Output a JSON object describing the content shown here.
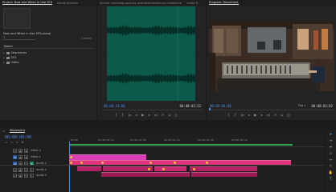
{
  "project": {
    "tab_project": "Project: Now and When in Use SFX",
    "tab_media": "Media Browser",
    "name": "Now and When in Use SFX.prproj",
    "items_count": "3 Items",
    "column_name": "Name",
    "bins": [
      "Sequences",
      "SFX",
      "Video"
    ]
  },
  "source": {
    "tab_label": "Source: studiobg-pass-by-overhead-stationary-ambience",
    "tab_audio": "Audio Tr",
    "tc_left": "00:00:14:06",
    "tc_right": "00:00:02:22",
    "waveform_color": "#0c5a4a"
  },
  "program": {
    "tab_label": "Program: Movement",
    "tc_left": "00:00:00:00",
    "zoom": "Full",
    "tc_right": "00:00:03:02"
  },
  "timeline": {
    "tab_label": "Movement",
    "timecode": "00:00:00:00",
    "ruler_ticks": [
      ":00:00",
      "00:00:00:12",
      "00:00:01:00",
      "00:00:01:12",
      "00:00:02:00",
      "00:00:02:12"
    ],
    "tracks": [
      {
        "id": "V2",
        "name": "Video 2",
        "kind": "video"
      },
      {
        "id": "V1",
        "name": "Video 1",
        "kind": "video"
      },
      {
        "id": "A1",
        "name": "Audio 1",
        "kind": "audio"
      },
      {
        "id": "A2",
        "name": "Audio 2",
        "kind": "audio"
      },
      {
        "id": "A3",
        "name": "Audio 3",
        "kind": "audio"
      }
    ],
    "clip_colors": {
      "video_clip": "#d93fb5",
      "audio_clip": "#e0357a",
      "audio_clip_dark": "#b51f63",
      "work_area": "#2fa34f"
    }
  },
  "tools": [
    "selection-tool",
    "track-select-tool",
    "ripple-edit-tool",
    "razor-tool",
    "slip-tool",
    "pen-tool",
    "hand-tool",
    "type-tool"
  ],
  "colors": {
    "accent_blue": "#4a90e2",
    "panel_bg": "#232323",
    "app_bg": "#1a1a1a"
  }
}
